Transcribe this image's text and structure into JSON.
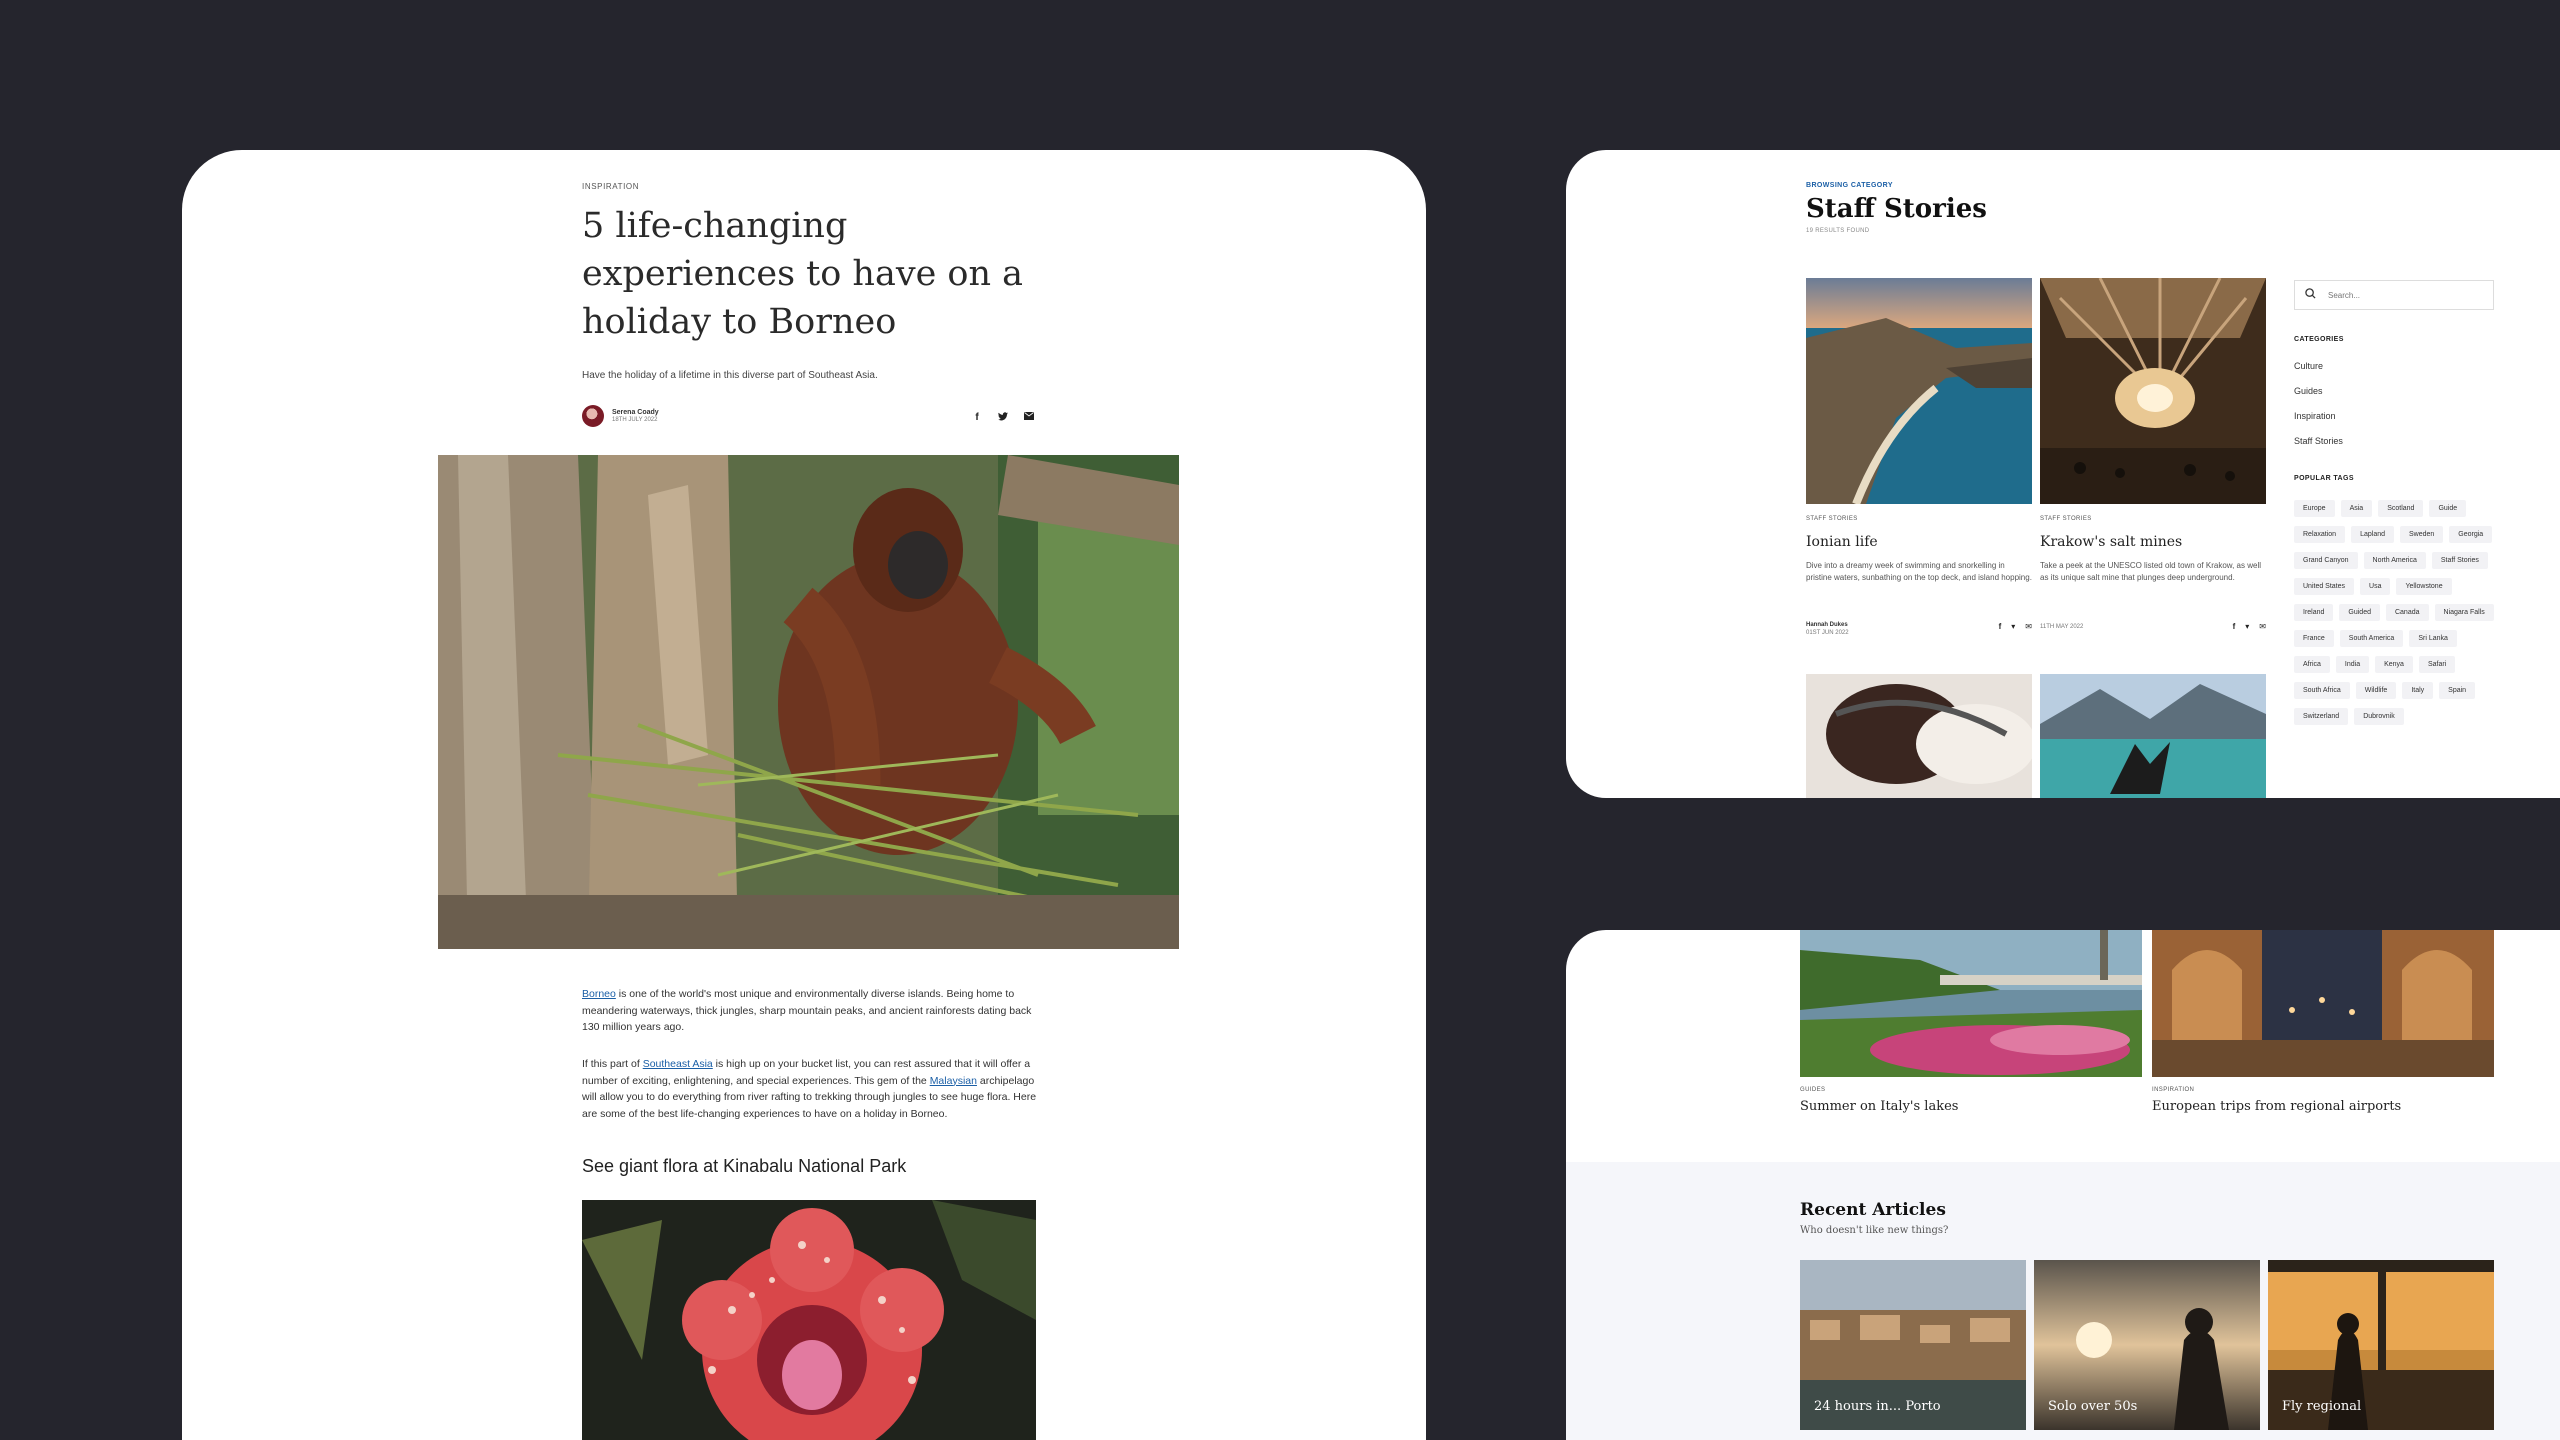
{
  "article": {
    "category": "INSPIRATION",
    "title": "5 life-changing experiences to have on a holiday to Borneo",
    "subtitle": "Have the holiday of a lifetime in this diverse part of Southeast Asia.",
    "author": "Serena Coady",
    "date": "18TH JULY 2022",
    "share_icons": [
      "facebook-icon",
      "twitter-icon",
      "email-icon"
    ],
    "p1_link": "Borneo",
    "p1_text": " is one of the world's most unique and environmentally diverse islands. Being home to meandering waterways, thick jungles, sharp mountain peaks, and ancient rainforests dating back 130 million years ago.",
    "p2_a": "If this part of ",
    "p2_link1": "Southeast Asia",
    "p2_b": " is high up on your bucket list, you can rest assured that it will offer a number of exciting, enlightening, and special experiences. This gem of the ",
    "p2_link2": "Malaysian",
    "p2_c": " archipelago will allow you to do everything from river rafting to trekking through jungles to see huge flora. Here are some of the best life-changing experiences to have on a holiday in Borneo.",
    "heading": "See giant flora at Kinabalu National Park"
  },
  "staff": {
    "browsing": "BROWSING CATEGORY",
    "title": "Staff Stories",
    "results": "19 RESULTS FOUND",
    "cards": [
      {
        "kicker": "STAFF STORIES",
        "title": "Ionian life",
        "excerpt": "Dive into a dreamy week of swimming and snorkelling in pristine waters, sunbathing on the top deck, and island hopping.",
        "author": "Hannah Dukes",
        "date": "01ST JUN 2022"
      },
      {
        "kicker": "STAFF STORIES",
        "title": "Krakow's salt mines",
        "excerpt": "Take a peek at the UNESCO listed old town of Krakow, as well as its unique salt mine that plunges deep underground.",
        "author": "",
        "date": "11TH MAY 2022"
      }
    ],
    "search_placeholder": "Search...",
    "categories_heading": "CATEGORIES",
    "categories": [
      "Culture",
      "Guides",
      "Inspiration",
      "Staff Stories"
    ],
    "tags_heading": "POPULAR TAGS",
    "tags": [
      "Europe",
      "Asia",
      "Scotland",
      "Guide",
      "Relaxation",
      "Lapland",
      "Sweden",
      "Georgia",
      "Grand Canyon",
      "North America",
      "Staff Stories",
      "United States",
      "Usa",
      "Yellowstone",
      "Ireland",
      "Guided",
      "Canada",
      "Niagara Falls",
      "France",
      "South America",
      "Sri Lanka",
      "Africa",
      "India",
      "Kenya",
      "Safari",
      "South Africa",
      "Wildlife",
      "Italy",
      "Spain",
      "Switzerland",
      "Dubrovnik"
    ]
  },
  "recent": {
    "guide_cards": [
      {
        "kicker": "GUIDES",
        "title": "Summer on Italy's lakes"
      },
      {
        "kicker": "INSPIRATION",
        "title": "European trips from regional airports"
      }
    ],
    "title": "Recent Articles",
    "subtitle": "Who doesn't like new things?",
    "cards": [
      "24 hours in... Porto",
      "Solo over 50s",
      "Fly regional"
    ]
  }
}
